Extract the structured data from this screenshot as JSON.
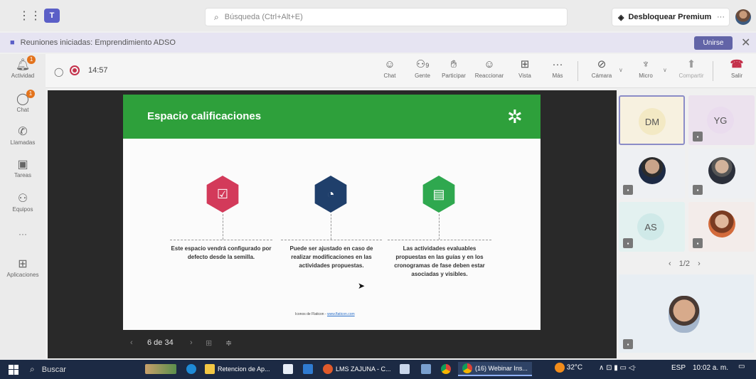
{
  "titlebar": {
    "search_placeholder": "Búsqueda (Ctrl+Alt+E)",
    "premium_label": "Desbloquear Premium",
    "more": "···"
  },
  "banner": {
    "text": "Reuniones iniciadas: Emprendimiento ADSO",
    "join_label": "Unirse"
  },
  "rail": [
    {
      "icon": "bell-icon",
      "label": "Actividad",
      "badge": "1"
    },
    {
      "icon": "chat-icon",
      "label": "Chat",
      "badge": "1"
    },
    {
      "icon": "phone-icon",
      "label": "Llamadas"
    },
    {
      "icon": "tasks-icon",
      "label": "Tareas"
    },
    {
      "icon": "teams-icon",
      "label": "Equipos"
    },
    {
      "icon": "more-icon",
      "label": "···"
    },
    {
      "icon": "apps-icon",
      "label": "Aplicaciones"
    }
  ],
  "meeting": {
    "timer": "14:57",
    "buttons": {
      "chat": "Chat",
      "people": "Gente",
      "people_count": "9",
      "raise": "Participar",
      "react": "Reaccionar",
      "view": "Vista",
      "more": "Más",
      "camera": "Cámara",
      "mic": "Micro",
      "share": "Compartir",
      "leave": "Salir"
    }
  },
  "slide": {
    "title": "Espacio calificaciones",
    "items": [
      {
        "text": "Este espacio vendrá configurado por defecto desde la semilla.",
        "color": "#d33a5a",
        "icon": "checklist-icon"
      },
      {
        "text": "Puede ser ajustado en caso de realizar modificaciones en las actividades propuestas.",
        "color": "#1f3f6b",
        "icon": "gauge-icon"
      },
      {
        "text": "Las actividades evaluables propuestas en las guías y en los cronogramas de fase deben estar asociadas y visibles.",
        "color": "#2fa84f",
        "icon": "document-search-icon"
      }
    ],
    "credit": "Iconos de Flaticon -",
    "credit_link": "www.flaticon.com",
    "page": "6 de 34"
  },
  "participants": [
    {
      "initials": "DM",
      "color": "#f3e9c4",
      "selected": true
    },
    {
      "initials": "YG",
      "color": "#eadcee"
    },
    {
      "photo": true
    },
    {
      "photo": true
    },
    {
      "initials": "AS",
      "color": "#cfe9e8"
    },
    {
      "photo": true
    }
  ],
  "pager": "1/2",
  "taskbar": {
    "search": "Buscar",
    "apps": [
      "Retencion de Ap...",
      "LMS ZAJUNA - C...",
      "(16) Webinar Ins..."
    ],
    "weather": "32°C",
    "lang": "ESP",
    "time": "10:02 a. m."
  }
}
